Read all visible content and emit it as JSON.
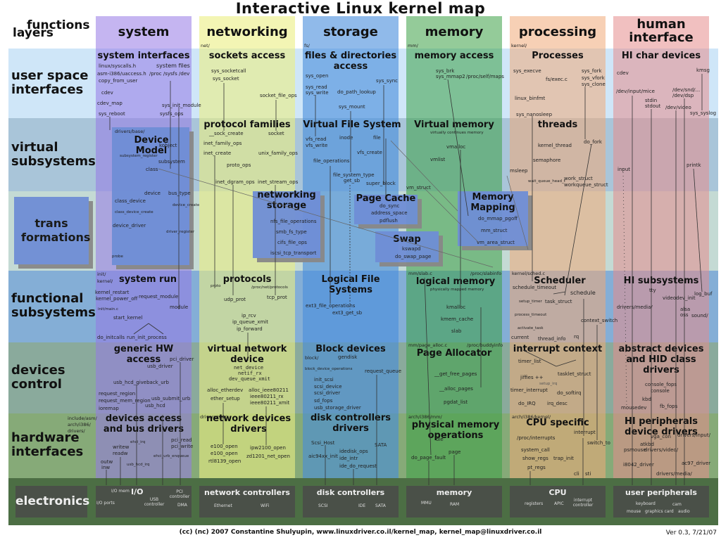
{
  "title": "Interactive Linux kernel map",
  "corner": {
    "functions": "functions",
    "layers": "layers"
  },
  "columns": [
    {
      "id": "system",
      "label": "system",
      "path": "",
      "color": "#b5a5e8"
    },
    {
      "id": "networking",
      "label": "networking",
      "path": "net/",
      "color": "#eef0a0"
    },
    {
      "id": "storage",
      "label": "storage",
      "path": "fs/",
      "color": "#7aaae6"
    },
    {
      "id": "memory",
      "label": "memory",
      "path": "mm/",
      "color": "#8ccc8c"
    },
    {
      "id": "processing",
      "label": "processing",
      "path": "kernel/",
      "color": "#f6c8a8"
    },
    {
      "id": "human_interface",
      "label": "human interface",
      "path": "",
      "color": "#f0b0b0"
    }
  ],
  "rows": [
    {
      "id": "user_space",
      "label": "user space interfaces",
      "color": "#cfe6f8"
    },
    {
      "id": "virtual",
      "label": "virtual subsystems",
      "color": "#a8c4d8"
    },
    {
      "id": "bridges",
      "label": "",
      "color": "#c4dad4"
    },
    {
      "id": "functional",
      "label": "functional subsystems",
      "color": "#84aed6"
    },
    {
      "id": "devices_control",
      "label": "devices control",
      "color": "#8aaa9c"
    },
    {
      "id": "hardware",
      "label": "hardware interfaces",
      "color": "#86aa78"
    },
    {
      "id": "electronics",
      "label": "electronics",
      "color": "#4c6e44"
    }
  ],
  "transformations_label": "trans formations",
  "cells": {
    "system_user": {
      "title": "system interfaces",
      "symbols": [
        "linux/syscalls.h",
        "asm-i386/uaccess.h",
        "copy_from_user",
        "system files",
        "/proc  /sysfs  /dev",
        "cdev",
        "cdev_map",
        "sys_init_module",
        "sys_reboot",
        "sysfs_ops"
      ]
    },
    "net_user": {
      "title": "sockets access",
      "symbols": [
        "sys_socketcall",
        "sys_socket",
        "socket_file_ops"
      ]
    },
    "storage_user": {
      "title": "files & directories access",
      "symbols": [
        "sys_open",
        "sys_read",
        "sys_write",
        "do_path_lookup",
        "sys_sync",
        "sys_mount"
      ]
    },
    "memory_user": {
      "title": "memory access",
      "symbols": [
        "sys_brk",
        "sys_mmap2",
        "/proc/self/maps"
      ]
    },
    "proc_user": {
      "title": "Processes",
      "symbols": [
        "sys_execve",
        "fs/exec.c",
        "sys_fork",
        "sys_vfork",
        "sys_clone",
        "linux_binfmt",
        "sys_nanosleep"
      ]
    },
    "hi_user": {
      "title": "HI char devices",
      "symbols": [
        "cdev",
        "kmsg",
        "/dev/input/mice",
        "/dev/snd/...",
        "/dev/dsp",
        "stdin",
        "stdout",
        "/dev/video",
        "sys_syslog"
      ]
    },
    "system_virtual": {
      "title": "Device Model",
      "path": "drivers/base/",
      "symbols": [
        "kobject",
        "subsystem_register",
        "subsystem",
        "class",
        "device",
        "bus_type",
        "device_create",
        "class_device",
        "class_device_create",
        "device_driver",
        "driver_register",
        "probe"
      ]
    },
    "net_virtual": {
      "title": "protocol families",
      "symbols": [
        "__sock_create",
        "socket",
        "inet_family_ops",
        "inet_create",
        "unix_family_ops",
        "proto_ops",
        "inet_dgram_ops",
        "inet_stream_ops"
      ]
    },
    "storage_virtual": {
      "title": "Virtual File System",
      "symbols": [
        "vfs_read",
        "vfs_write",
        "inode",
        "file",
        "vfs_create",
        "file_operations",
        "file_system_type",
        "get_sb",
        "super_block"
      ]
    },
    "memory_virtual": {
      "title": "Virtual memory",
      "subtitle": "virtually continues memory",
      "symbols": [
        "vmalloc",
        "vmlist",
        "vm_struct"
      ]
    },
    "proc_virtual": {
      "title": "threads",
      "symbols": [
        "kernel_thread",
        "do_fork",
        "semaphore",
        "msleep",
        "wait_queue_head_t",
        "work_struct",
        "workqueue_struct"
      ]
    },
    "hi_virtual": {
      "symbols": [
        "input",
        "printk"
      ]
    },
    "net_storage": {
      "title": "networking storage",
      "symbols": [
        "nfs_file_operations",
        "smb_fs_type",
        "cifs_file_ops",
        "iscsi_tcp_transport"
      ]
    },
    "page_cache": {
      "title": "Page Cache",
      "symbols": [
        "do_sync",
        "address_space",
        "pdflush"
      ]
    },
    "swap": {
      "title": "Swap",
      "symbols": [
        "kswapd",
        "do_swap_page"
      ]
    },
    "memory_mapping": {
      "title": "Memory Mapping",
      "symbols": [
        "do_mmap_pgoff",
        "mm_struct",
        "vm_area_struct"
      ]
    },
    "system_functional": {
      "title": "system run",
      "paths": [
        "init/",
        "kernel/"
      ],
      "symbols": [
        "kernel_restart",
        "kernel_power_off",
        "request_module",
        "module",
        "init/main.c",
        "start_kernel",
        "do_initcalls",
        "run_init_process"
      ]
    },
    "net_functional": {
      "title": "protocols",
      "symbols": [
        "proto",
        "/proc/net/protocols",
        "udp_prot",
        "tcp_prot",
        "ip_rcv",
        "ip_queue_xmit",
        "ip_forward"
      ]
    },
    "storage_functional": {
      "title": "Logical File Systems",
      "symbols": [
        "ext3_file_operations",
        "ext3_get_sb"
      ]
    },
    "memory_functional": {
      "title": "logical memory",
      "subtitle": "physically mapped memory",
      "paths": [
        "mm/slab.c",
        "/proc/slabinfo"
      ],
      "symbols": [
        "kmalloc",
        "kmem_cache",
        "slab"
      ]
    },
    "proc_functional": {
      "title": "Scheduler",
      "paths": [
        "kernel/sched.c"
      ],
      "symbols": [
        "schedule_timeout",
        "schedule",
        "setup_timer",
        "task_struct",
        "process_timeout",
        "context_switch",
        "activate_task",
        "rq",
        "current",
        "thread_info"
      ]
    },
    "hi_functional": {
      "title": "HI subsystems",
      "symbols": [
        "tty",
        "log_buf",
        "videodev_init",
        "drivers/media/",
        "alsa",
        "oss",
        "sound/"
      ]
    },
    "system_devices": {
      "title": "generic HW access",
      "symbols": [
        "pci_driver",
        "usb_driver",
        "usb_hcd_giveback_urb",
        "request_region",
        "request_mem_region",
        "ioremap",
        "usb_submit_urb",
        "usb_hcd"
      ]
    },
    "net_devices": {
      "title": "virtual network device",
      "symbols": [
        "net_device",
        "netif_rx",
        "dev_queue_xmit",
        "alloc_etherdev",
        "ether_setup",
        "alloc_ieee80211",
        "ieee80211_rx",
        "ieee80211_xmit"
      ]
    },
    "storage_devices": {
      "title": "Block devices",
      "paths": [
        "block/"
      ],
      "symbols": [
        "gendisk",
        "block_device_operations",
        "request_queue",
        "init_scsi",
        "scsi_device",
        "scsi_driver",
        "sd_fops",
        "usb_storage_driver"
      ]
    },
    "memory_devices": {
      "title": "Page Allocator",
      "paths": [
        "mm/page_alloc.c",
        "/proc/buddyinfo"
      ],
      "symbols": [
        "__get_free_pages",
        "__alloc_pages",
        "pgdat_list"
      ]
    },
    "proc_devices": {
      "title": "interrupt context",
      "symbols": [
        "timer_list",
        "jiffies ++",
        "tasklet_struct",
        "setup_irq",
        "timer_interrupt",
        "do_softirq",
        "do_IRQ",
        "irq_desc"
      ]
    },
    "hi_devices": {
      "title": "abstract devices and HID class drivers",
      "symbols": [
        "console_fops",
        "console",
        "kbd",
        "mousedev",
        "fb_fops"
      ]
    },
    "system_hw": {
      "title": "devices access and bus drivers",
      "paths": [
        "include/asm/",
        "arch/i386/",
        "drivers/"
      ],
      "symbols": [
        "ehci_irq",
        "pci_read",
        "pci_write",
        "writew",
        "readw",
        "ehci_urb_enqueue",
        "outw",
        "inw",
        "usb_hcd_irq"
      ]
    },
    "net_hw": {
      "title": "network devices drivers",
      "paths": [
        "drivers/net/"
      ],
      "symbols": [
        "e100_open",
        "e100_open",
        "rtl8139_open",
        "ipw2100_open",
        "zd1201_net_open"
      ]
    },
    "storage_hw": {
      "title": "disk controllers drivers",
      "symbols": [
        "Scsi_Host",
        "aic94xx_init",
        "idedisk_ops",
        "ide_intr",
        "ide_do_request",
        "SATA"
      ]
    },
    "memory_hw": {
      "title": "physical memory operations",
      "paths": [
        "arch/i386/mm/"
      ],
      "symbols": [
        "die",
        "do_page_fault",
        "page"
      ]
    },
    "proc_hw": {
      "title": "CPU specific",
      "paths": [
        "arch/i386/kernel/"
      ],
      "symbols": [
        "interrupt",
        "/proc/interrupts",
        "switch_to",
        "system_call",
        "show_regs",
        "trap_init",
        "pt_regs",
        "cli",
        "sti"
      ]
    },
    "hi_hw": {
      "title": "HI peripherals device drivers",
      "symbols": [
        "vga_con",
        "drivers/input/",
        "atkbd",
        "psmouse",
        "drivers/video/",
        "i8042_driver",
        "ac97_driver",
        "drivers/media/"
      ]
    }
  },
  "electronics": {
    "label": "electronics",
    "groups": [
      {
        "title": "I/O",
        "items": [
          "I/O mem",
          "I/O ports",
          "USB controller",
          "PCI controller",
          "DMA"
        ]
      },
      {
        "title": "network controllers",
        "items": [
          "Ethernet",
          "WiFi"
        ]
      },
      {
        "title": "disk controllers",
        "items": [
          "SCSI",
          "IDE",
          "SATA"
        ]
      },
      {
        "title": "memory",
        "items": [
          "MMU",
          "RAM"
        ]
      },
      {
        "title": "CPU",
        "items": [
          "registers",
          "APIC",
          "interrupt controller"
        ]
      },
      {
        "title": "user peripherals",
        "items": [
          "keyboard",
          "cam",
          "mouse",
          "graphics card",
          "audio"
        ]
      }
    ]
  },
  "footer": "(cc) (nc) 2007 Constantine Shulyupin, www.linuxdriver.co.il/kernel_map, kernel_map@linuxdriver.co.il",
  "version": "Ver 0.3, 7/21/07"
}
